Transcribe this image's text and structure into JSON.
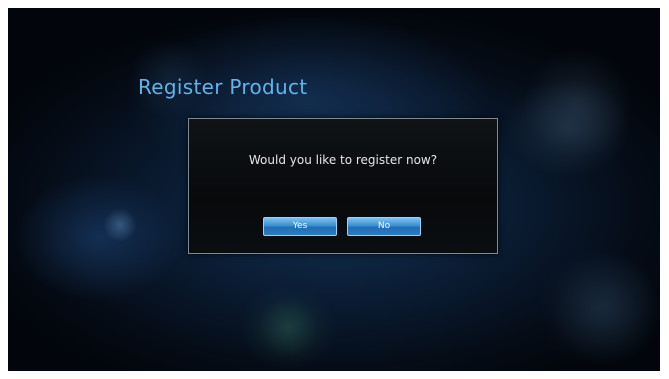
{
  "screen": {
    "title": "Register Product"
  },
  "dialog": {
    "message": "Would you like to register now?",
    "yes_label": "Yes",
    "no_label": "No"
  },
  "colors": {
    "title": "#5fb4ea",
    "button_fill": "#2a7cc0",
    "dialog_border": "#7d8a96",
    "background": "#0a1c33"
  }
}
